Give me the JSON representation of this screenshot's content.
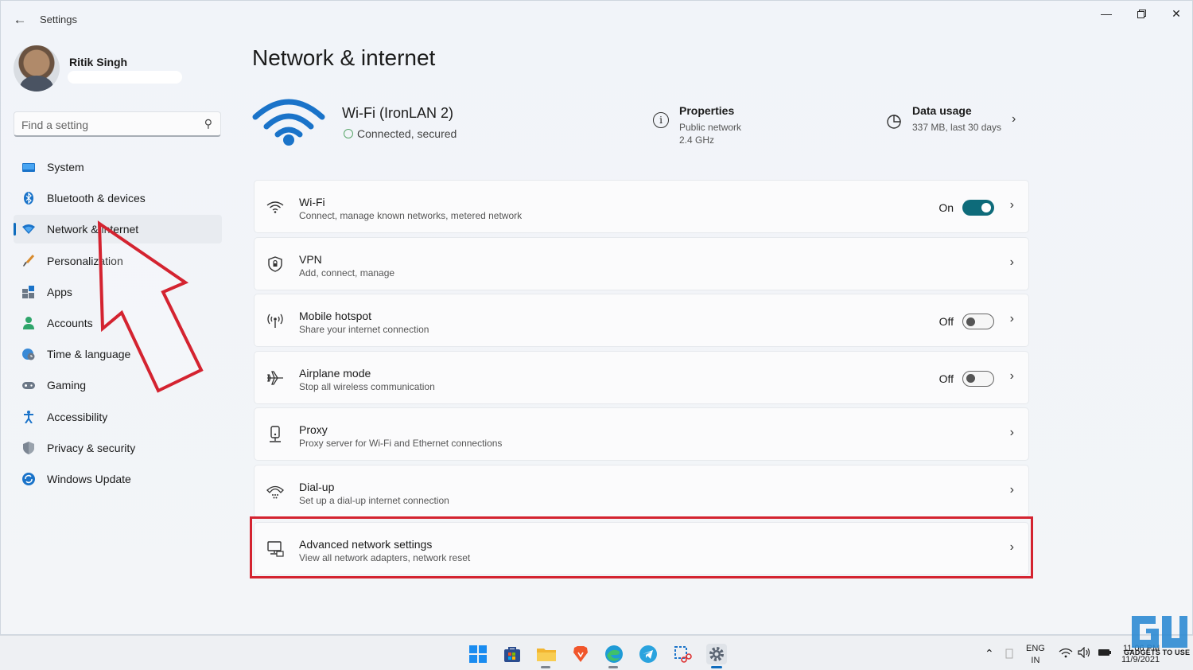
{
  "window": {
    "title": "Settings",
    "back_icon": "back-arrow-icon",
    "controls": [
      "minimize-icon",
      "restore-icon",
      "close-icon"
    ]
  },
  "profile": {
    "name": "Ritik Singh"
  },
  "search": {
    "placeholder": "Find a setting",
    "value": ""
  },
  "sidebar": {
    "items": [
      {
        "label": "System",
        "icon": "system-icon",
        "active": false
      },
      {
        "label": "Bluetooth & devices",
        "icon": "bluetooth-icon",
        "active": false
      },
      {
        "label": "Network & internet",
        "icon": "network-icon",
        "active": true
      },
      {
        "label": "Personalization",
        "icon": "brush-icon",
        "active": false
      },
      {
        "label": "Apps",
        "icon": "apps-icon",
        "active": false
      },
      {
        "label": "Accounts",
        "icon": "accounts-icon",
        "active": false
      },
      {
        "label": "Time & language",
        "icon": "globe-clock-icon",
        "active": false
      },
      {
        "label": "Gaming",
        "icon": "gamepad-icon",
        "active": false
      },
      {
        "label": "Accessibility",
        "icon": "accessibility-icon",
        "active": false
      },
      {
        "label": "Privacy & security",
        "icon": "shield-icon",
        "active": false
      },
      {
        "label": "Windows Update",
        "icon": "update-icon",
        "active": false
      }
    ]
  },
  "main": {
    "title": "Network & internet",
    "connection": {
      "name": "Wi-Fi (IronLAN 2)",
      "status": "Connected, secured"
    },
    "properties": {
      "title": "Properties",
      "line1": "Public network",
      "line2": "2.4 GHz"
    },
    "data_usage": {
      "title": "Data usage",
      "subtitle": "337 MB, last 30 days"
    },
    "cards": [
      {
        "title": "Wi-Fi",
        "desc": "Connect, manage known networks, metered network",
        "toggle": "On",
        "toggle_on": true,
        "icon": "wifi-icon"
      },
      {
        "title": "VPN",
        "desc": "Add, connect, manage",
        "toggle": "",
        "icon": "vpn-shield-icon"
      },
      {
        "title": "Mobile hotspot",
        "desc": "Share your internet connection",
        "toggle": "Off",
        "toggle_on": false,
        "icon": "hotspot-icon"
      },
      {
        "title": "Airplane mode",
        "desc": "Stop all wireless communication",
        "toggle": "Off",
        "toggle_on": false,
        "icon": "airplane-icon"
      },
      {
        "title": "Proxy",
        "desc": "Proxy server for Wi-Fi and Ethernet connections",
        "toggle": "",
        "icon": "proxy-icon"
      },
      {
        "title": "Dial-up",
        "desc": "Set up a dial-up internet connection",
        "toggle": "",
        "icon": "dialup-icon"
      },
      {
        "title": "Advanced network settings",
        "desc": "View all network adapters, network reset",
        "toggle": "",
        "icon": "advanced-network-icon"
      }
    ]
  },
  "taskbar": {
    "apps": [
      "start-icon",
      "store-icon",
      "file-explorer-icon",
      "brave-icon",
      "edge-icon",
      "telegram-icon",
      "snipping-tool-icon",
      "settings-icon"
    ],
    "language_line1": "ENG",
    "language_line2": "IN",
    "time": "11:06 PM",
    "date": "11/9/2021",
    "watermark": "GADGETS TO USE"
  },
  "colors": {
    "accent": "#0f6cbd",
    "toggle_on": "#0e6b7a",
    "highlight_box": "#d42330"
  }
}
